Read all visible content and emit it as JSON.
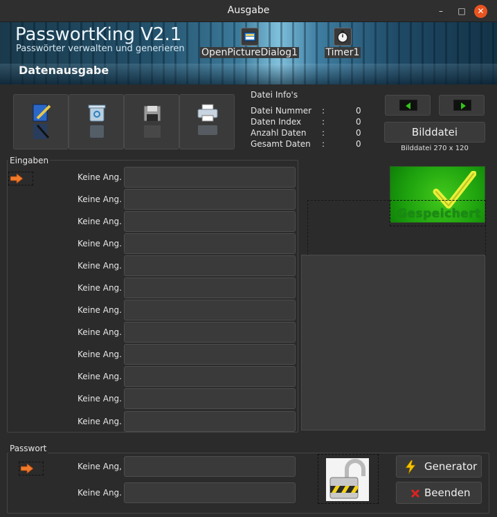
{
  "window": {
    "title": "Ausgabe",
    "min": "–",
    "max": "□",
    "close": "✕"
  },
  "banner": {
    "title": "PasswortKing V2.1",
    "subtitle": "Passwörter verwalten und generieren",
    "section": "Datenausgabe"
  },
  "components": {
    "open_picture_dialog": "OpenPictureDialog1",
    "timer": "Timer1"
  },
  "toolbar": {
    "items": [
      {
        "name": "edit-icon"
      },
      {
        "name": "recycle-bin-icon"
      },
      {
        "name": "floppy-disk-icon"
      },
      {
        "name": "printer-icon"
      }
    ]
  },
  "info": {
    "title": "Datei Info's",
    "rows": [
      {
        "label": "Datei Nummer",
        "colon": ":",
        "value": "0"
      },
      {
        "label": "Daten Index",
        "colon": ":",
        "value": "0"
      },
      {
        "label": "Anzahl Daten",
        "colon": ":",
        "value": "0"
      },
      {
        "label": "Gesamt Daten",
        "colon": ":",
        "value": "0"
      }
    ]
  },
  "image": {
    "button_label": "Bilddatei",
    "info": "Bilddatei 270 x 120",
    "saved_text": "Gespeichert"
  },
  "eingaben": {
    "title": "Eingaben",
    "rows": [
      {
        "label": "Keine Ang.",
        "value": ""
      },
      {
        "label": "Keine Ang.",
        "value": ""
      },
      {
        "label": "Keine Ang.",
        "value": ""
      },
      {
        "label": "Keine Ang.",
        "value": ""
      },
      {
        "label": "Keine Ang.",
        "value": ""
      },
      {
        "label": "Keine Ang.",
        "value": ""
      },
      {
        "label": "Keine Ang.",
        "value": ""
      },
      {
        "label": "Keine Ang.",
        "value": ""
      },
      {
        "label": "Keine Ang.",
        "value": ""
      },
      {
        "label": "Keine Ang.",
        "value": ""
      },
      {
        "label": "Keine Ang.",
        "value": ""
      },
      {
        "label": "Keine Ang.",
        "value": ""
      }
    ]
  },
  "passwort": {
    "title": "Passwort",
    "rows": [
      {
        "label": "Keine Ang,",
        "value": ""
      },
      {
        "label": "Keine Ang.",
        "value": ""
      }
    ],
    "generator_label": "Generator",
    "beenden_label": "Beenden"
  },
  "colors": {
    "accent_orange": "#e95420",
    "saved_green": "#2bb414",
    "arrow_green": "#35c21a"
  }
}
